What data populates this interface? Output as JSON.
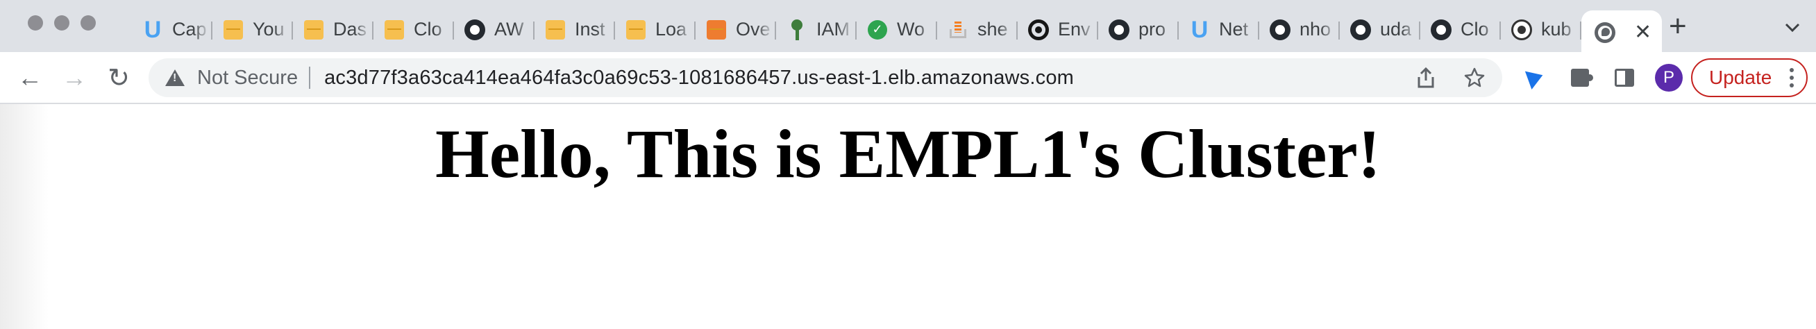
{
  "browser": {
    "tabs": [
      {
        "title": "Cap",
        "icon": "udacity-icon"
      },
      {
        "title": "You",
        "icon": "aws-box-icon"
      },
      {
        "title": "Das",
        "icon": "aws-box-icon"
      },
      {
        "title": "Clo",
        "icon": "aws-box-icon"
      },
      {
        "title": "AW",
        "icon": "github-icon"
      },
      {
        "title": "Inst",
        "icon": "aws-box-icon"
      },
      {
        "title": "Loa",
        "icon": "aws-box-icon"
      },
      {
        "title": "Ove",
        "icon": "aws-orange-box-icon"
      },
      {
        "title": "IAM",
        "icon": "key-icon"
      },
      {
        "title": "Wo",
        "icon": "check-circle-icon"
      },
      {
        "title": "she",
        "icon": "stackoverflow-icon"
      },
      {
        "title": "Env",
        "icon": "circleci-icon"
      },
      {
        "title": "pro",
        "icon": "github-icon"
      },
      {
        "title": "Net",
        "icon": "udacity-icon"
      },
      {
        "title": "nho",
        "icon": "github-icon"
      },
      {
        "title": "uda",
        "icon": "github-icon"
      },
      {
        "title": "Clo",
        "icon": "github-icon"
      },
      {
        "title": "kub",
        "icon": "kubernetes-icon"
      }
    ],
    "active_tab": {
      "icon": "globe-icon",
      "close": "✕"
    },
    "new_tab": "+",
    "nav": {
      "back": "←",
      "forward": "→",
      "reload": "↻"
    },
    "address_bar": {
      "security_label": "Not Secure",
      "url": "ac3d77f3a63ca414ea464fa3c0a69c53-1081686457.us-east-1.elb.amazonaws.com"
    },
    "profile_initial": "P",
    "update_label": "Update"
  },
  "page": {
    "heading": "Hello, This is EMPL1's Cluster!"
  }
}
